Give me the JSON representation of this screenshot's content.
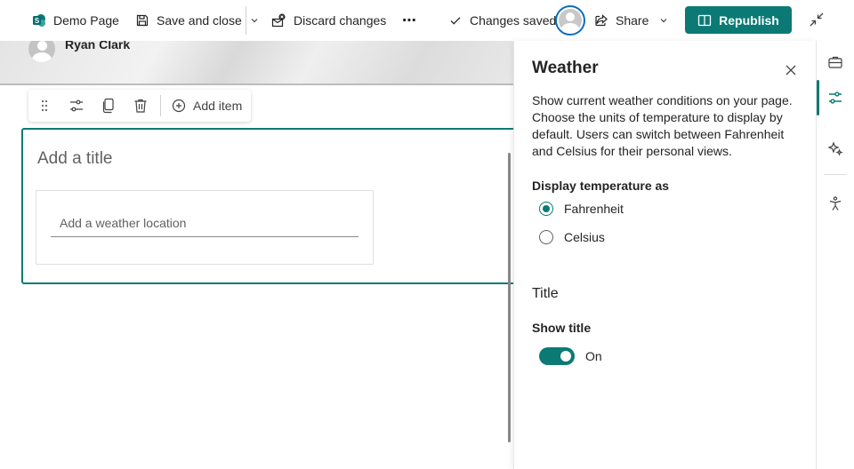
{
  "topbar": {
    "page_name": "Demo Page",
    "save_close_label": "Save and close",
    "discard_label": "Discard changes",
    "more_label": "⋯",
    "status_label": "Changes saved",
    "share_label": "Share",
    "republish_label": "Republish"
  },
  "banner": {
    "author_name": "Ryan Clark"
  },
  "webpart_toolbar": {
    "add_item_label": "Add item"
  },
  "webpart": {
    "title_placeholder": "Add a title",
    "location_placeholder": "Add a weather location"
  },
  "pane": {
    "title": "Weather",
    "description": "Show current weather conditions on your page. Choose the units of temperature to display by default. Users can switch between Fahrenheit and Celsius for their personal views.",
    "display_label": "Display temperature as",
    "options": [
      {
        "label": "Fahrenheit",
        "selected": true
      },
      {
        "label": "Celsius",
        "selected": false
      }
    ],
    "section_title": "Title",
    "show_title_label": "Show title",
    "toggle_state": "On"
  },
  "colors": {
    "accent": "#0b7a75",
    "focus_ring": "#0f6cbd"
  }
}
